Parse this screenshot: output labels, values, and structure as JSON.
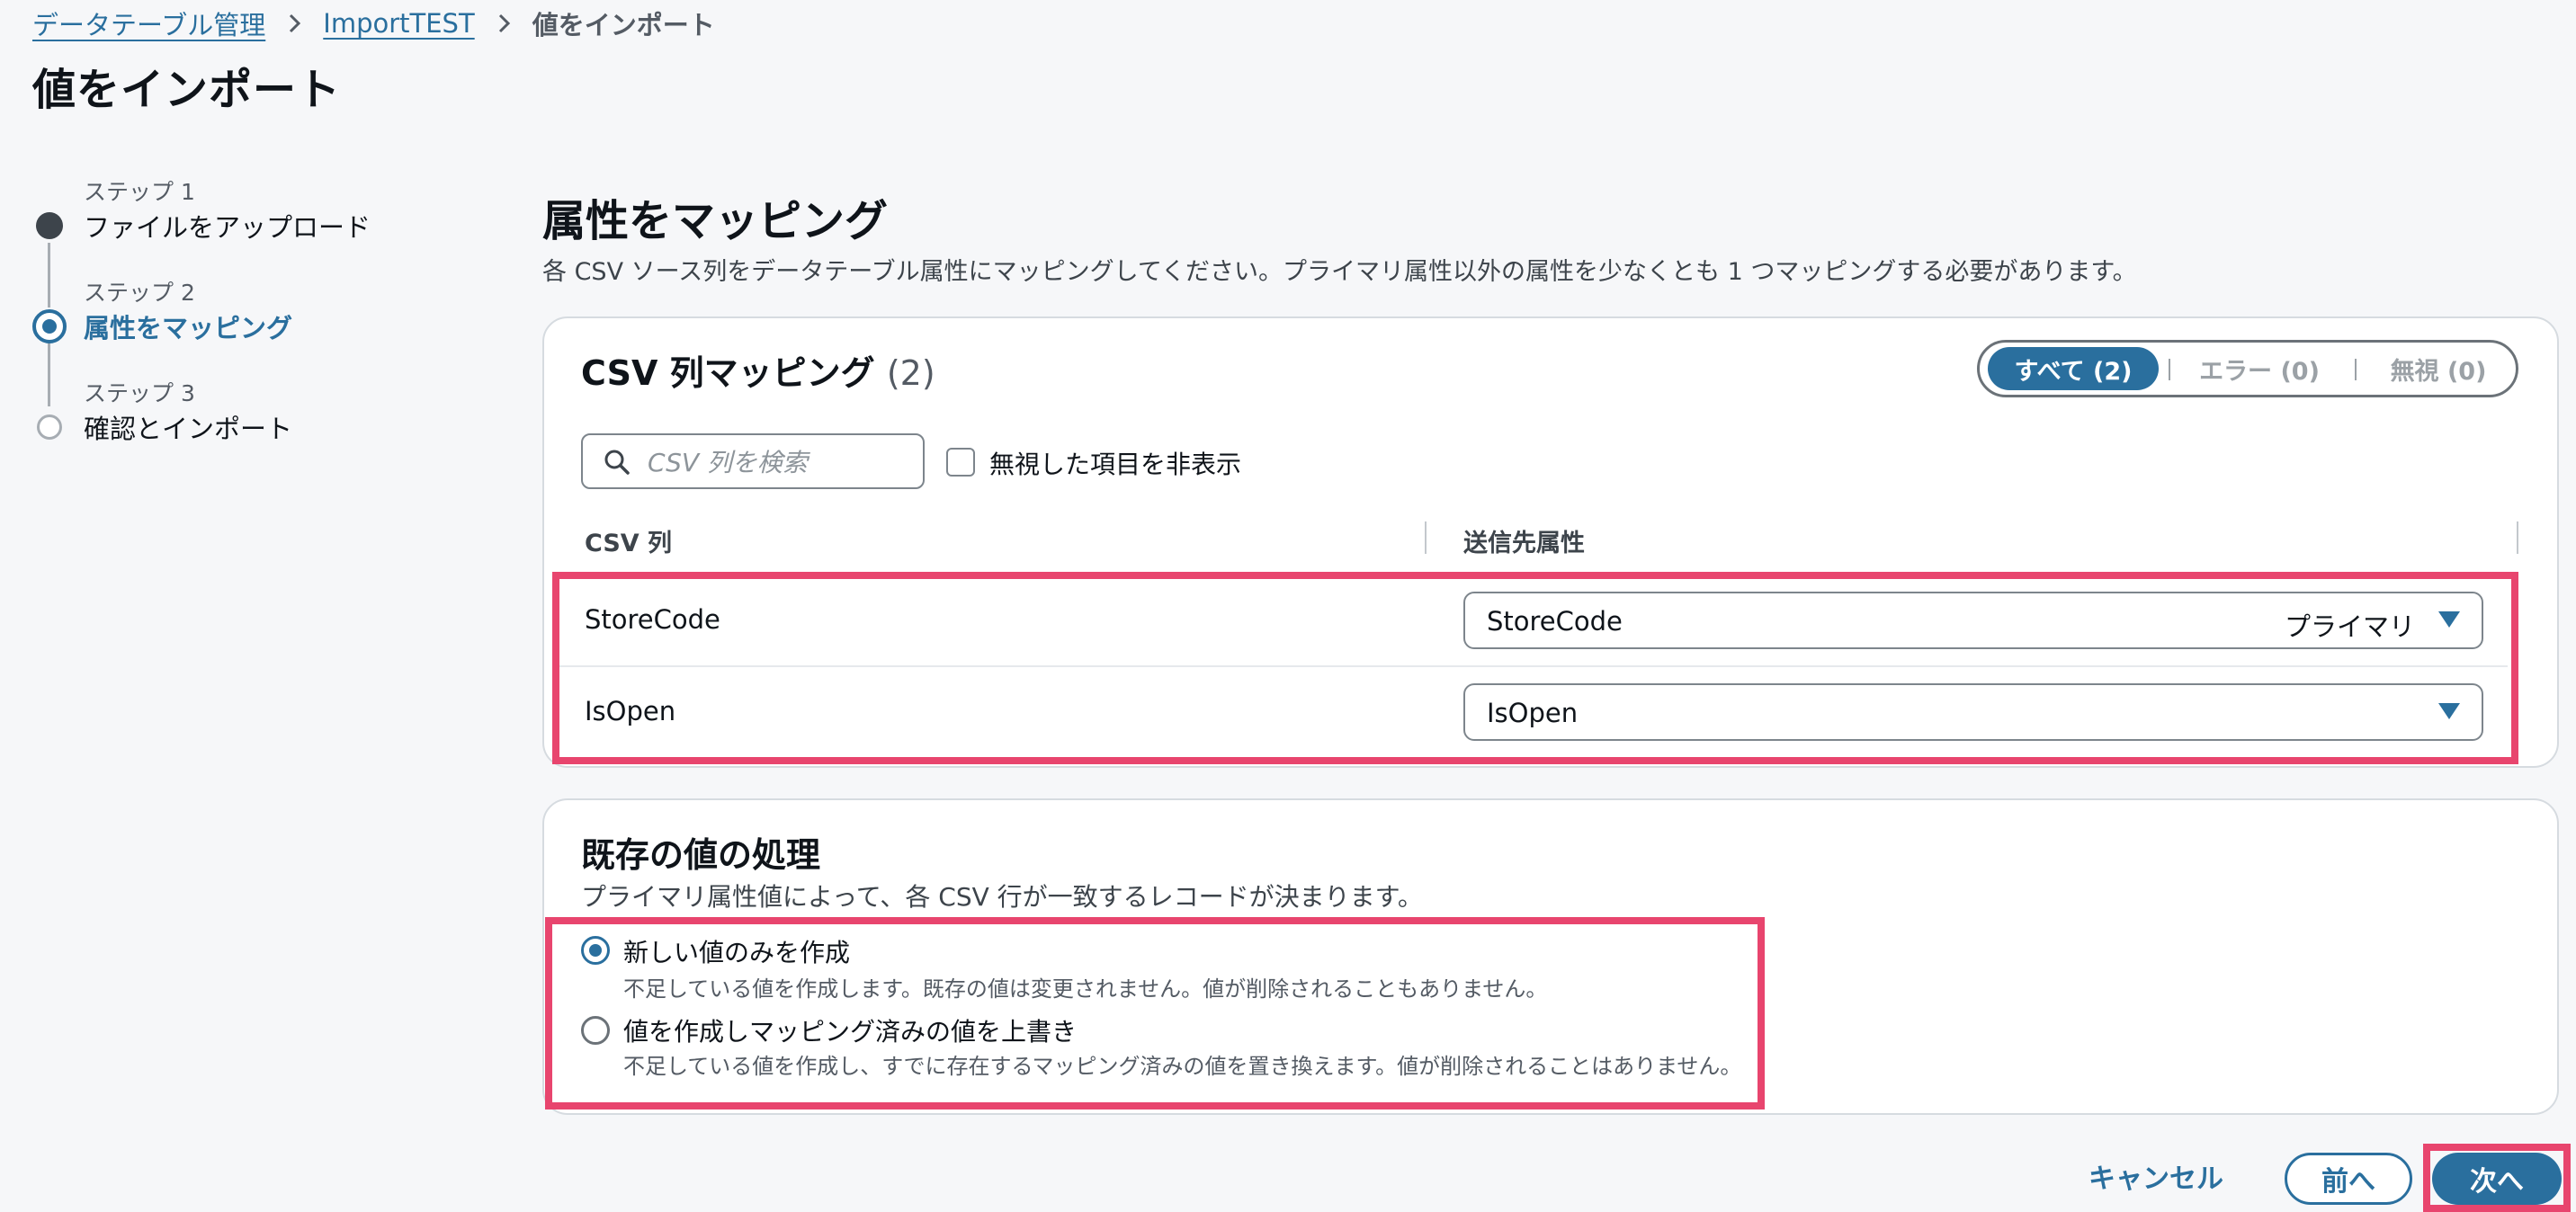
{
  "breadcrumb": {
    "items": [
      "データテーブル管理",
      "ImportTEST"
    ],
    "current": "値をインポート"
  },
  "page": {
    "title": "値をインポート"
  },
  "steps": [
    {
      "label": "ステップ 1",
      "title": "ファイルをアップロード",
      "state": "completed"
    },
    {
      "label": "ステップ 2",
      "title": "属性をマッピング",
      "state": "active"
    },
    {
      "label": "ステップ 3",
      "title": "確認とインポート",
      "state": "pending"
    }
  ],
  "section": {
    "title": "属性をマッピング",
    "description": "各 CSV ソース列をデータテーブル属性にマッピングしてください。プライマリ属性以外の属性を少なくとも 1 つマッピングする必要があります。"
  },
  "mapping_panel": {
    "title": "CSV 列マッピング",
    "count": "(2)",
    "filters": {
      "all": "すべて (2)",
      "errors": "エラー (0)",
      "ignored": "無視 (0)",
      "selected": "all"
    },
    "search": {
      "placeholder": "CSV 列を検索",
      "value": ""
    },
    "hide_ignored": {
      "label": "無視した項目を非表示",
      "checked": false
    },
    "columns": {
      "csv": "CSV 列",
      "target": "送信先属性"
    },
    "rows": [
      {
        "csv_column": "StoreCode",
        "target": "StoreCode",
        "badge": "プライマリ"
      },
      {
        "csv_column": "IsOpen",
        "target": "IsOpen",
        "badge": ""
      }
    ]
  },
  "existing_panel": {
    "title": "既存の値の処理",
    "description": "プライマリ属性値によって、各 CSV 行が一致するレコードが決まります。",
    "options": [
      {
        "label": "新しい値のみを作成",
        "description": "不足している値を作成します。既存の値は変更されません。値が削除されることもありません。",
        "selected": true
      },
      {
        "label": "値を作成しマッピング済みの値を上書き",
        "description": "不足している値を作成し、すでに存在するマッピング済みの値を置き換えます。値が削除されることはありません。",
        "selected": false
      }
    ]
  },
  "footer": {
    "cancel": "キャンセル",
    "previous": "前へ",
    "next": "次へ"
  },
  "colors": {
    "accent": "#2a6f9e",
    "highlight": "#e8456e",
    "background": "#f6f7f9"
  }
}
